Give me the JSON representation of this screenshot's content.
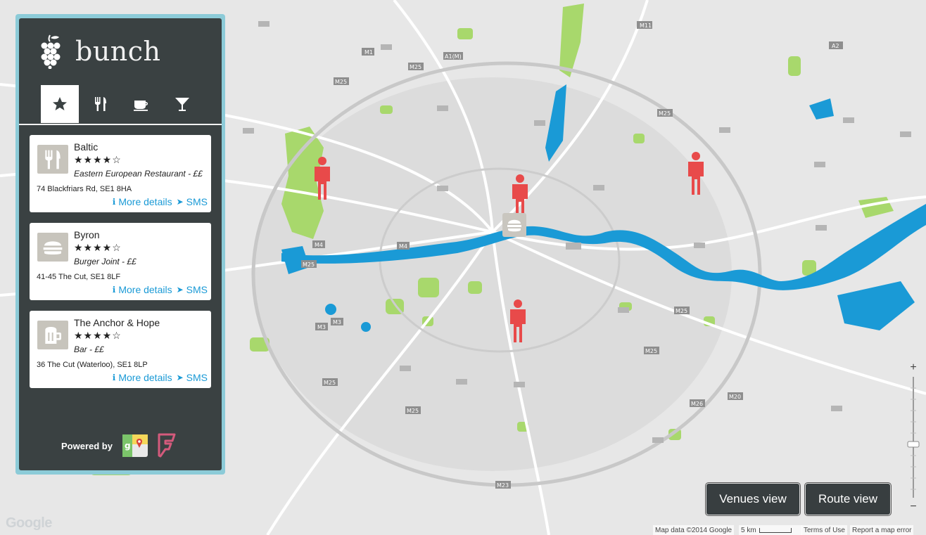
{
  "app": {
    "name": "bunch"
  },
  "tabs": [
    {
      "icon": "star-icon"
    },
    {
      "icon": "fork-knife-icon"
    },
    {
      "icon": "coffee-cup-icon"
    },
    {
      "icon": "cocktail-glass-icon"
    }
  ],
  "venues": [
    {
      "name": "Baltic",
      "rating": "★★★★☆",
      "category": "Eastern European Restaurant - ££",
      "address": "74 Blackfriars Rd, SE1 8HA",
      "details_label": "More details",
      "sms_label": "SMS",
      "icon": "fork-knife-icon"
    },
    {
      "name": "Byron",
      "rating": "★★★★☆",
      "category": "Burger Joint - ££",
      "address": "41-45 The Cut, SE1 8LF",
      "details_label": "More details",
      "sms_label": "SMS",
      "icon": "burger-icon"
    },
    {
      "name": "The Anchor & Hope",
      "rating": "★★★★☆",
      "category": "Bar - ££",
      "address": "36 The Cut (Waterloo), SE1 8LP",
      "details_label": "More details",
      "sms_label": "SMS",
      "icon": "beer-mug-icon"
    }
  ],
  "powered_by": "Powered by",
  "buttons": {
    "venues_view": "Venues view",
    "route_view": "Route view"
  },
  "map": {
    "google_logo": "Google",
    "map_data": "Map data ©2014 Google",
    "scale": "5 km",
    "terms": "Terms of Use",
    "report": "Report a map error",
    "zoom_in": "+",
    "zoom_out": "−",
    "road_labels": [
      "M11",
      "M1",
      "A1(M)",
      "M25",
      "M25",
      "M25",
      "M25",
      "M25",
      "M4",
      "M4",
      "M3",
      "M25",
      "M25",
      "M25",
      "M26",
      "M20",
      "M23",
      "M25",
      "A2"
    ],
    "colors": {
      "land": "#e8e8e8",
      "park": "#a3d86a",
      "water": "#1a9ad6",
      "road": "#ffffff",
      "motorway": "#bdbdbd"
    }
  },
  "markers": {
    "person_color": "#e84a4a",
    "count": 4
  }
}
